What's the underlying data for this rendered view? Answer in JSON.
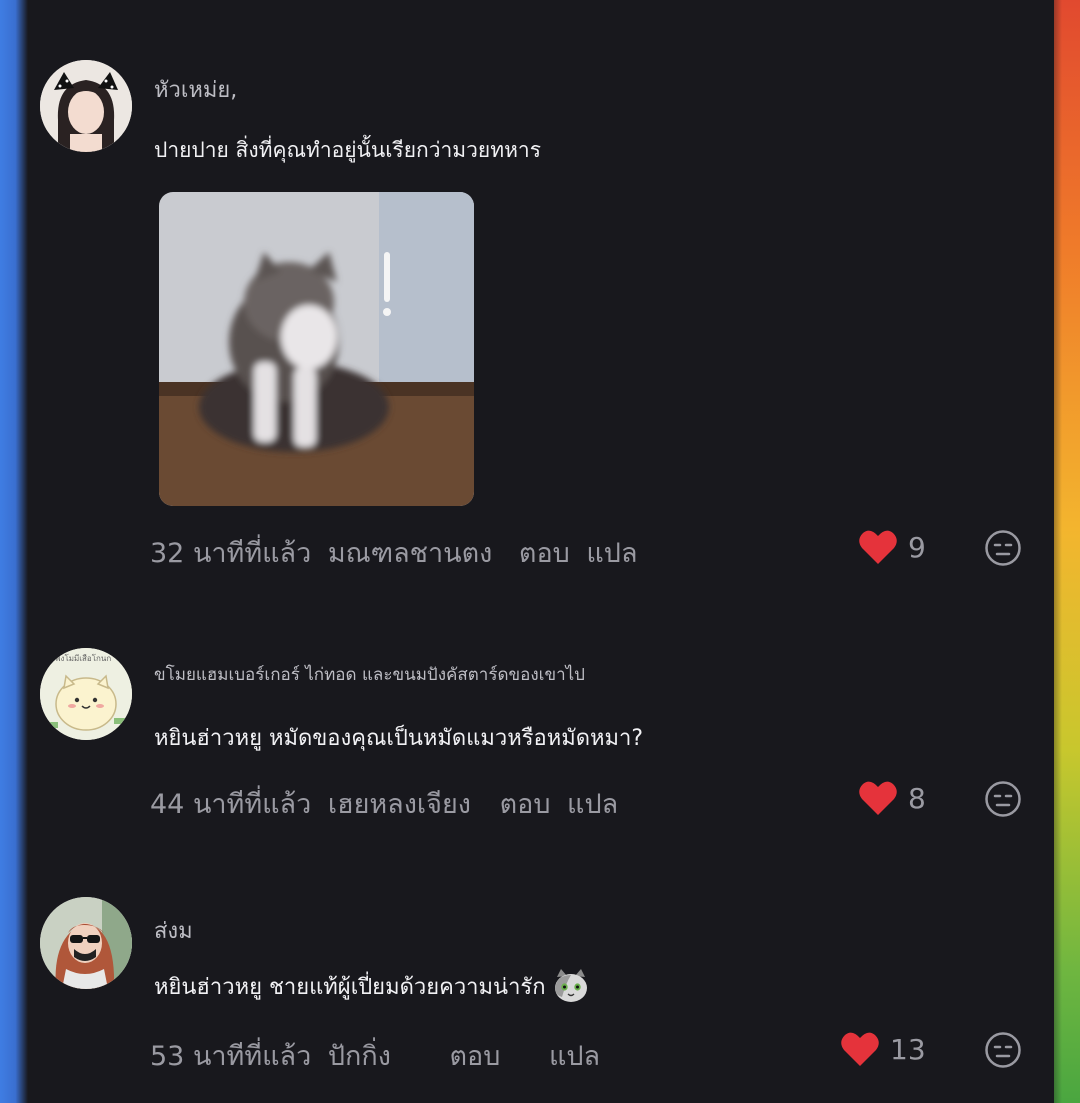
{
  "comments": [
    {
      "username": "หัวเหม่ย,",
      "text": "ปายปาย สิ่งที่คุณทำอยู่นั้นเรียกว่ามวยทหาร",
      "time": "32 นาทีที่แล้ว",
      "location": "มณฑลชานตง",
      "reply_label": "ตอบ",
      "translate_label": "แปล",
      "likes": "9",
      "has_image": true
    },
    {
      "avatar_text": "มีพ่งโมมีเสือโกนก",
      "username": "ขโมยแฮมเบอร์เกอร์ ไก่ทอด และขนมปังคัสตาร์ดของเขาไป",
      "text": "หยินฮ่าวหยู หมัดของคุณเป็นหมัดแมวหรือหมัดหมา?",
      "time": "44 นาทีที่แล้ว",
      "location": "เฮยหลงเจียง",
      "reply_label": "ตอบ",
      "translate_label": "แปล",
      "likes": "8"
    },
    {
      "username": "ส่งม",
      "text": "หยินฮ่าวหยู ชายแท้ผู้เปี่ยมด้วยความน่ารัก",
      "emoji": "cat-face-emoji",
      "time": "53 นาทีที่แล้ว",
      "location": "ปักกิ่ง",
      "reply_label": "ตอบ",
      "translate_label": "แปล",
      "likes": "13"
    }
  ],
  "colors": {
    "background": "#18181d",
    "heart": "#e5333b",
    "meta_text": "#9a9aa2",
    "left_edge": "#3f7de3"
  }
}
